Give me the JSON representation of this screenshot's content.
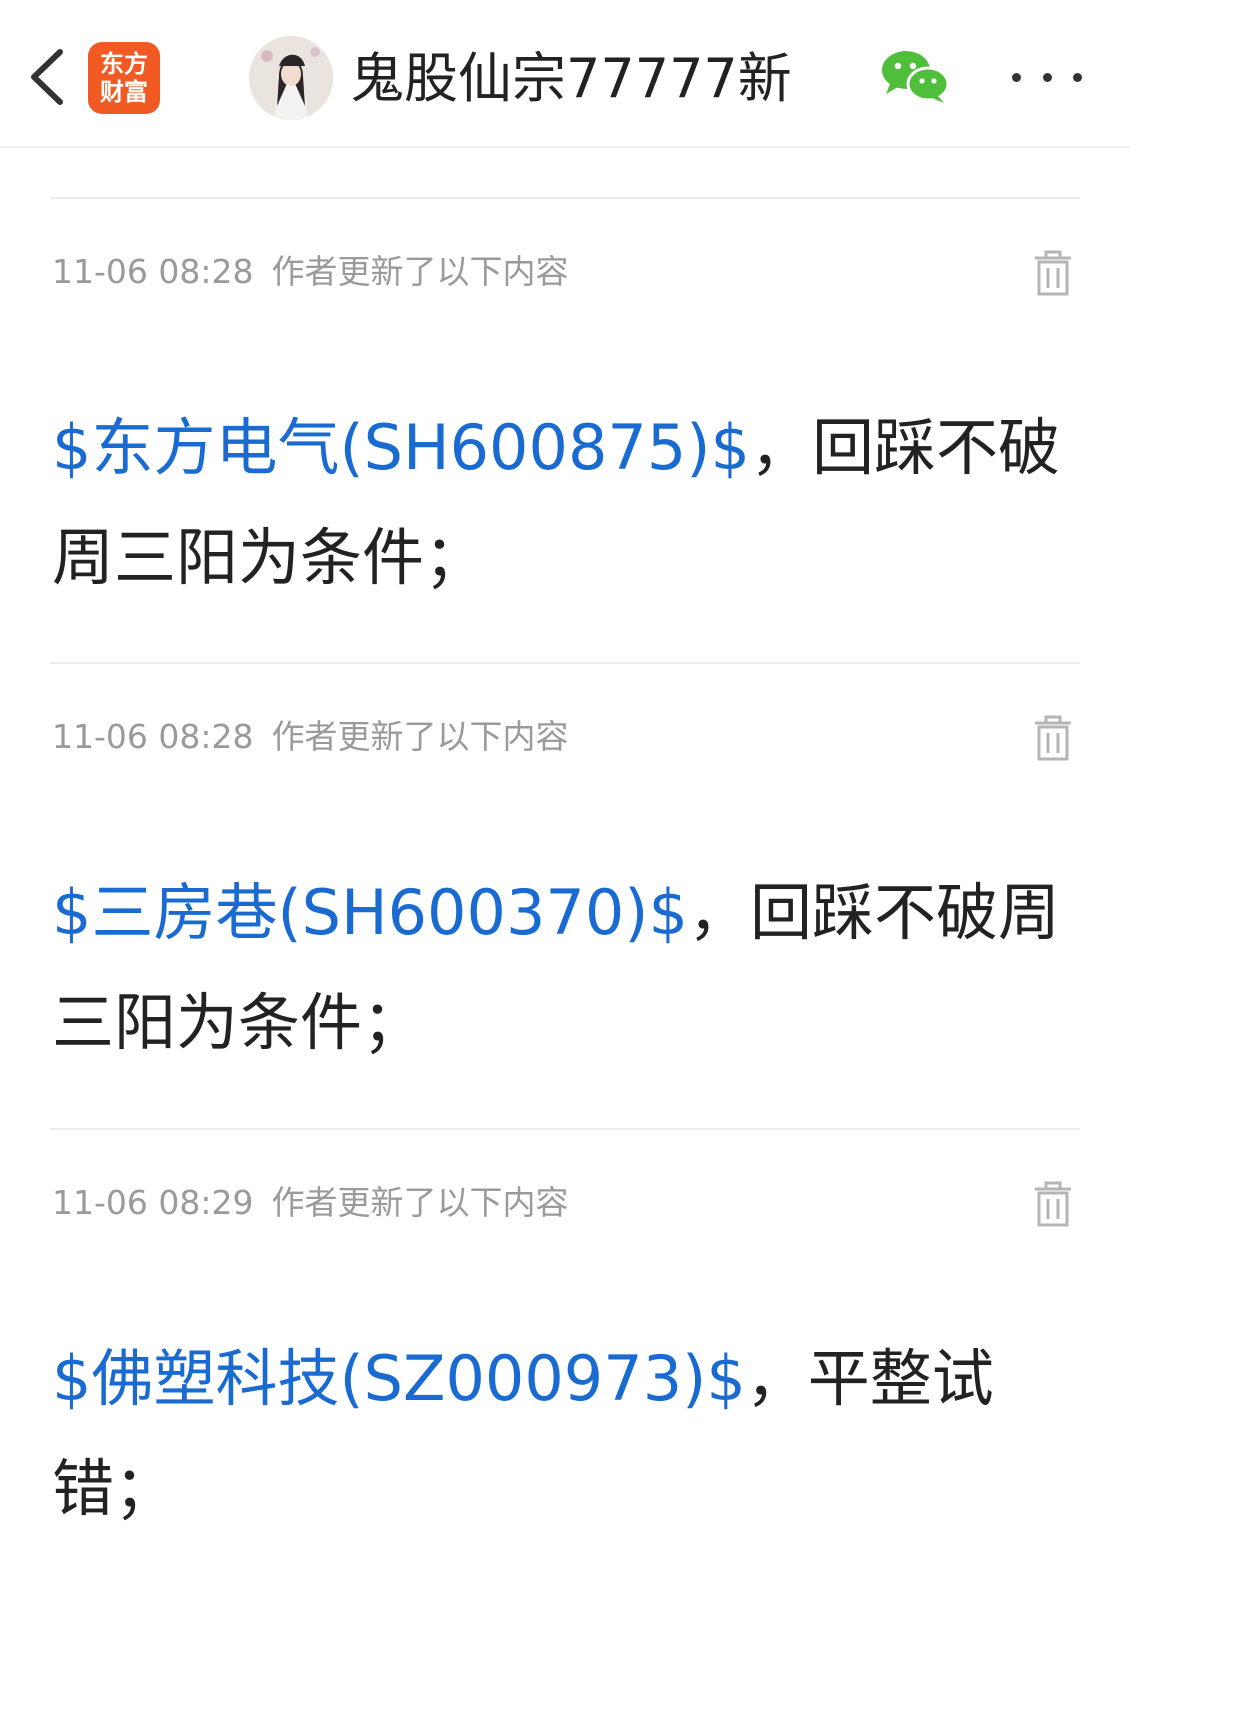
{
  "header": {
    "logo_line1": "东方",
    "logo_line2": "财富",
    "user_name": "鬼股仙宗77777新"
  },
  "icons": {
    "back": "chevron-left-icon",
    "wechat": "wechat-icon",
    "more": "more-dots-icon",
    "trash": "trash-icon"
  },
  "colors": {
    "link": "#1a6bd1",
    "logo_bg": "#f15a22",
    "wechat_green": "#4fbf3b",
    "meta_gray": "#9a9a9a"
  },
  "updates": [
    {
      "time": "11-06 08:28",
      "label": "作者更新了以下内容",
      "stock": "$东方电气(SH600875)$",
      "text": "，回踩不破周三阳为条件；"
    },
    {
      "time": "11-06 08:28",
      "label": "作者更新了以下内容",
      "stock": "$三房巷(SH600370)$",
      "text": "，回踩不破周三阳为条件；"
    },
    {
      "time": "11-06 08:29",
      "label": "作者更新了以下内容",
      "stock": "$佛塑科技(SZ000973)$",
      "text": "，平整试错；"
    }
  ]
}
